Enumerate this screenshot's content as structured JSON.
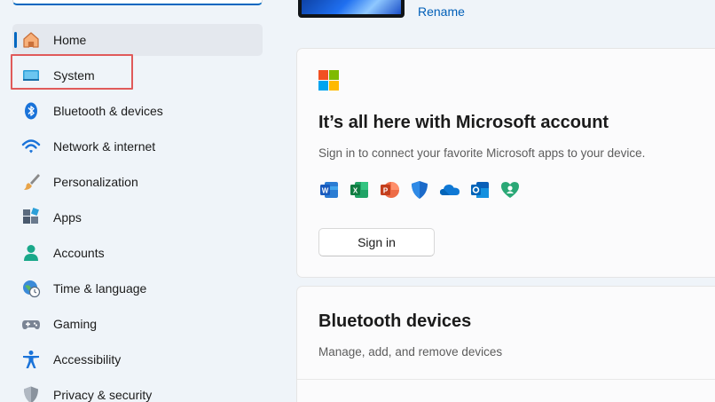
{
  "sidebar": {
    "items": [
      {
        "id": "home",
        "label": "Home",
        "icon": "home-icon",
        "selected": true
      },
      {
        "id": "system",
        "label": "System",
        "icon": "system-icon",
        "selected": false
      },
      {
        "id": "bluetooth",
        "label": "Bluetooth & devices",
        "icon": "bluetooth-icon",
        "selected": false
      },
      {
        "id": "network",
        "label": "Network & internet",
        "icon": "wifi-icon",
        "selected": false
      },
      {
        "id": "personalization",
        "label": "Personalization",
        "icon": "brush-icon",
        "selected": false
      },
      {
        "id": "apps",
        "label": "Apps",
        "icon": "apps-icon",
        "selected": false
      },
      {
        "id": "accounts",
        "label": "Accounts",
        "icon": "person-icon",
        "selected": false
      },
      {
        "id": "time",
        "label": "Time & language",
        "icon": "globe-clock-icon",
        "selected": false
      },
      {
        "id": "gaming",
        "label": "Gaming",
        "icon": "gamepad-icon",
        "selected": false
      },
      {
        "id": "accessibility",
        "label": "Accessibility",
        "icon": "accessibility-icon",
        "selected": false
      },
      {
        "id": "privacy",
        "label": "Privacy & security",
        "icon": "shield-icon",
        "selected": false
      }
    ]
  },
  "device": {
    "rename_label": "Rename"
  },
  "ms_account_card": {
    "title": "It’s all here with Microsoft account",
    "subtitle": "Sign in to connect your favorite Microsoft apps to your device.",
    "signin_label": "Sign in",
    "apps": [
      "word-icon",
      "excel-icon",
      "powerpoint-icon",
      "defender-icon",
      "onedrive-icon",
      "outlook-icon",
      "family-icon"
    ]
  },
  "bluetooth_card": {
    "title": "Bluetooth devices",
    "subtitle": "Manage, add, and remove devices"
  },
  "colors": {
    "accent": "#0067c0",
    "highlight": "#e05a5a"
  }
}
